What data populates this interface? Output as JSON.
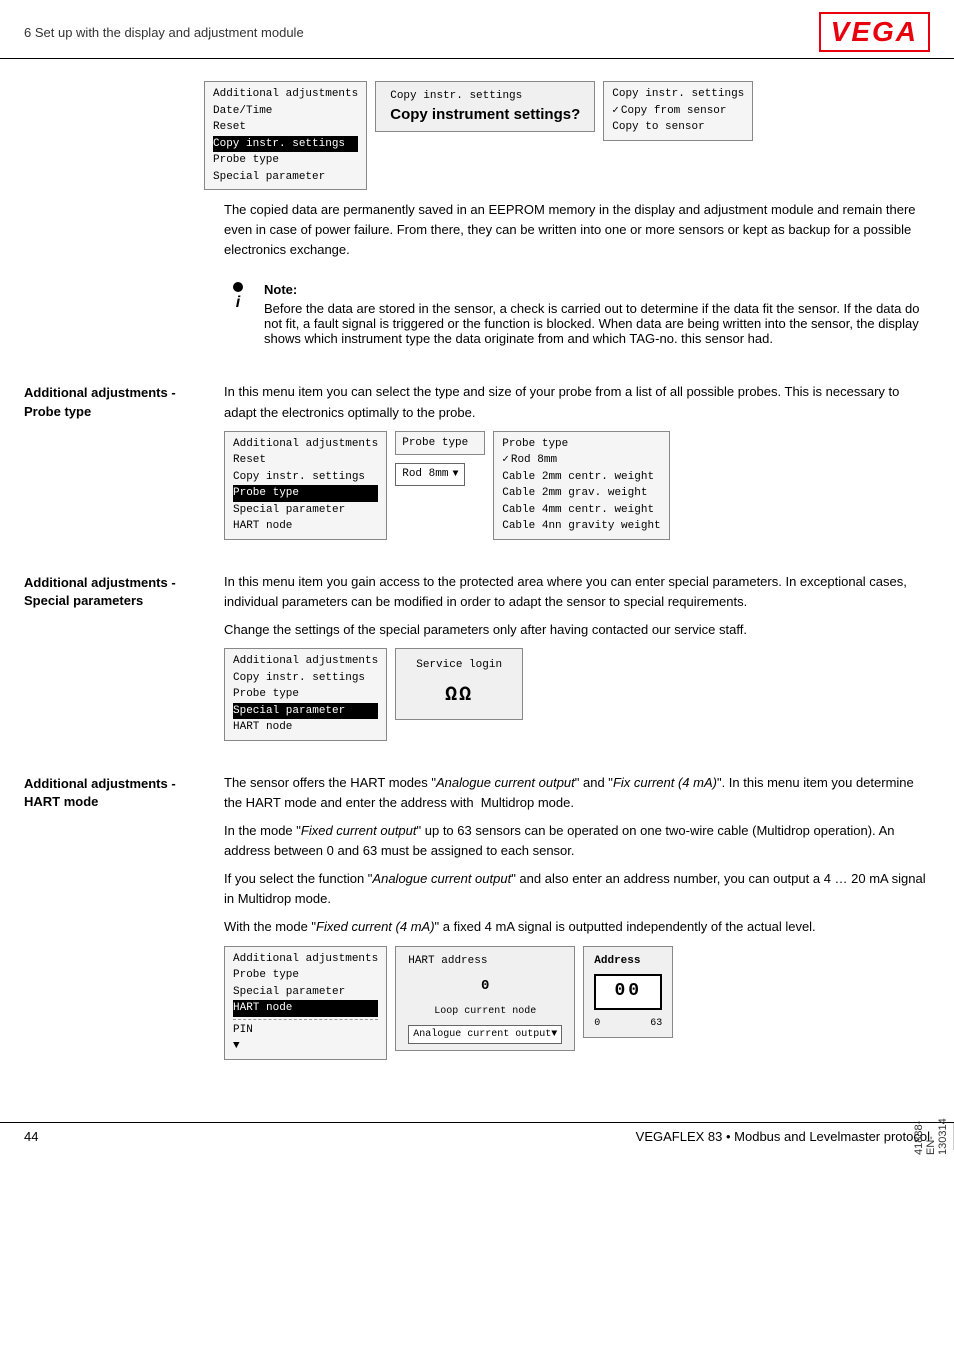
{
  "header": {
    "chapter": "6 Set up with the display and adjustment module",
    "logo": "VEGA"
  },
  "footer": {
    "page_number": "44",
    "product": "VEGAFLEX 83 • Modbus and Levelmaster protocol",
    "sidebar_id": "41838-EN-130314"
  },
  "top_ui": {
    "menu_label": "Copy instr. settings",
    "menu_items": [
      "Additional adjustments",
      "Date/Time",
      "Reset",
      "Copy instr. settings",
      "Probe type",
      "Special parameter"
    ],
    "menu_selected_index": 3,
    "dialog_title": "Copy instr. settings",
    "dialog_text": "Copy instrument settings?",
    "options_title": "Copy instr. settings",
    "options": [
      "Copy from sensor",
      "Copy to sensor"
    ],
    "options_selected_index": 0
  },
  "top_paragraph": "The copied data are permanently saved in an EEPROM memory in the display and adjustment module and remain there even in case of power failure. From there, they can be written into one or more sensors or kept as backup for a possible electronics exchange.",
  "note": {
    "title": "Note:",
    "text": "Before the data are stored in the sensor, a check is carried out to determine if the data fit the sensor. If the data do not fit, a fault signal is triggered or the function is blocked. When data are being written into the sensor, the display shows which instrument type the data originate from and which TAG-no. this sensor had."
  },
  "section_probe": {
    "label_line1": "Additional adjustments -",
    "label_line2": "Probe type",
    "intro": "In this menu item you can select the type and size of your probe from a list of all possible probes. This is necessary to adapt the electronics optimally to the probe.",
    "menu_items": [
      "Additional adjustments",
      "Reset",
      "Copy instr. settings",
      "Probe type",
      "Special parameter",
      "HART node"
    ],
    "menu_selected_index": 3,
    "probe_type_label": "Probe type",
    "probe_dropdown_value": "Rod 8mm",
    "probe_options_title": "Probe type",
    "probe_options": [
      "Rod 8mm",
      "Cable 2mm centr. weight",
      "Cable 2mm grav. weight",
      "Cable 4mm centr. weight",
      "Cable 4nn gravity weight"
    ],
    "probe_options_checked_index": 0
  },
  "section_special": {
    "label_line1": "Additional adjustments -",
    "label_line2": "Special parameters",
    "intro": "In this menu item you gain access to the protected area where you can enter special parameters. In exceptional cases, individual parameters can be modified in order to adapt the sensor to special requirements.",
    "change_note": "Change the settings of the special parameters only after having contacted our service staff.",
    "menu_items": [
      "Additional adjustments",
      "Copy instr. settings",
      "Probe type",
      "Special parameter",
      "HART node"
    ],
    "menu_selected_index": 3,
    "service_title": "Service login",
    "service_code": "ΩΩ"
  },
  "section_hart": {
    "label_line1": "Additional adjustments -",
    "label_line2": "HART mode",
    "para1": "The sensor offers the HART modes \"Analogue current output\" and \"Fix current (4 mA)\". In this menu item you determine the HART mode and enter the address with  Multidrop mode.",
    "para2": "In the mode \"Fixed current output\" up to 63 sensors can be operated on one two-wire cable (Multidrop operation). An address between 0 and 63 must be assigned to each sensor.",
    "para3": "If you select the function \"Analogue current output\" and also enter an address number, you can output a 4 … 20 mA signal in Multidrop mode.",
    "para4": "With the mode \"Fixed current (4 mA)\" a fixed 4 mA signal is outputted independently of the actual level.",
    "menu_items": [
      "Additional adjustments",
      "Probe type",
      "Special parameter",
      "HART node"
    ],
    "menu_dashes": "-------------------",
    "menu_pin": "PIN",
    "menu_selected_index": 3,
    "hart_title": "HART address",
    "hart_value": "0",
    "hart_loop_label": "Loop current node",
    "hart_loop_value": "Analogue current output",
    "address_title": "Address",
    "address_display": "00",
    "address_min": "0",
    "address_max": "63"
  }
}
